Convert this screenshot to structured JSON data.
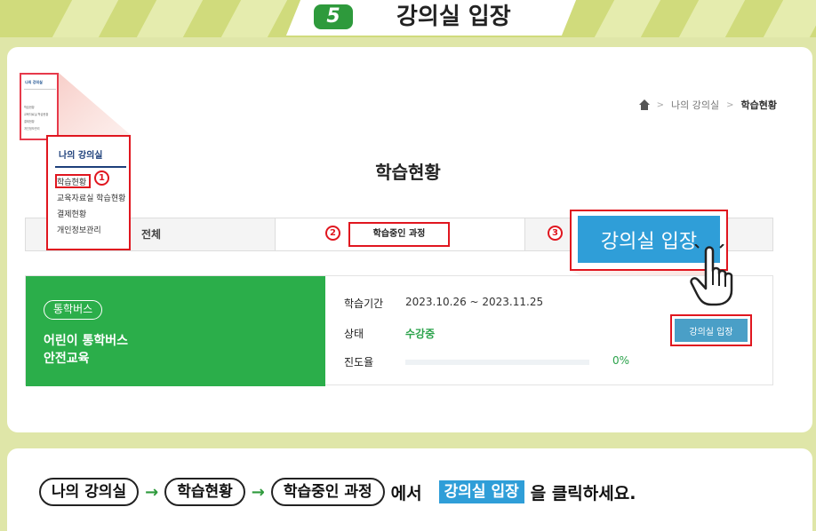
{
  "banner": {
    "step_number": "5",
    "title": "강의실 입장"
  },
  "breadcrumb": {
    "items": [
      "나의 강의실",
      "학습현황"
    ],
    "separator": ">"
  },
  "page_title": "학습현황",
  "sidebar_zoom": {
    "thumb_title": "나의 강의실",
    "thumb_items": [
      "학습현황",
      "교육자료실 학습현황",
      "결제현황",
      "개인정보관리"
    ],
    "title": "나의 강의실",
    "items": [
      "학습현황",
      "교육자료실 학습현황",
      "결제현황",
      "개인정보관리"
    ]
  },
  "tabs": {
    "all": "전체",
    "in_progress": "학습중인 과정"
  },
  "callouts": {
    "one": "1",
    "two": "2",
    "three": "3"
  },
  "course": {
    "badge": "통학버스",
    "title_line1": "어린이 통학버스",
    "title_line2": "안전교육",
    "period_label": "학습기간",
    "period_value": "2023.10.26 ~ 2023.11.25",
    "status_label": "상태",
    "status_value": "수강중",
    "progress_label": "진도율",
    "progress_value": "0%",
    "progress": 0,
    "enter_button": "강의실 입장"
  },
  "zoom_button": "강의실 입장",
  "instruction": {
    "step1": "나의 강의실",
    "step2": "학습현황",
    "step3": "학습중인 과정",
    "connector": "에서",
    "highlight": "강의실 입장",
    "suffix": "을 클릭하세요.",
    "arrow": "→"
  },
  "colors": {
    "banner_bg": "#d0db7c",
    "page_bg": "#dfe6a8",
    "brand_green": "#2bae4a",
    "accent_blue": "#2f9ed8",
    "callout_red": "#e0161f"
  }
}
